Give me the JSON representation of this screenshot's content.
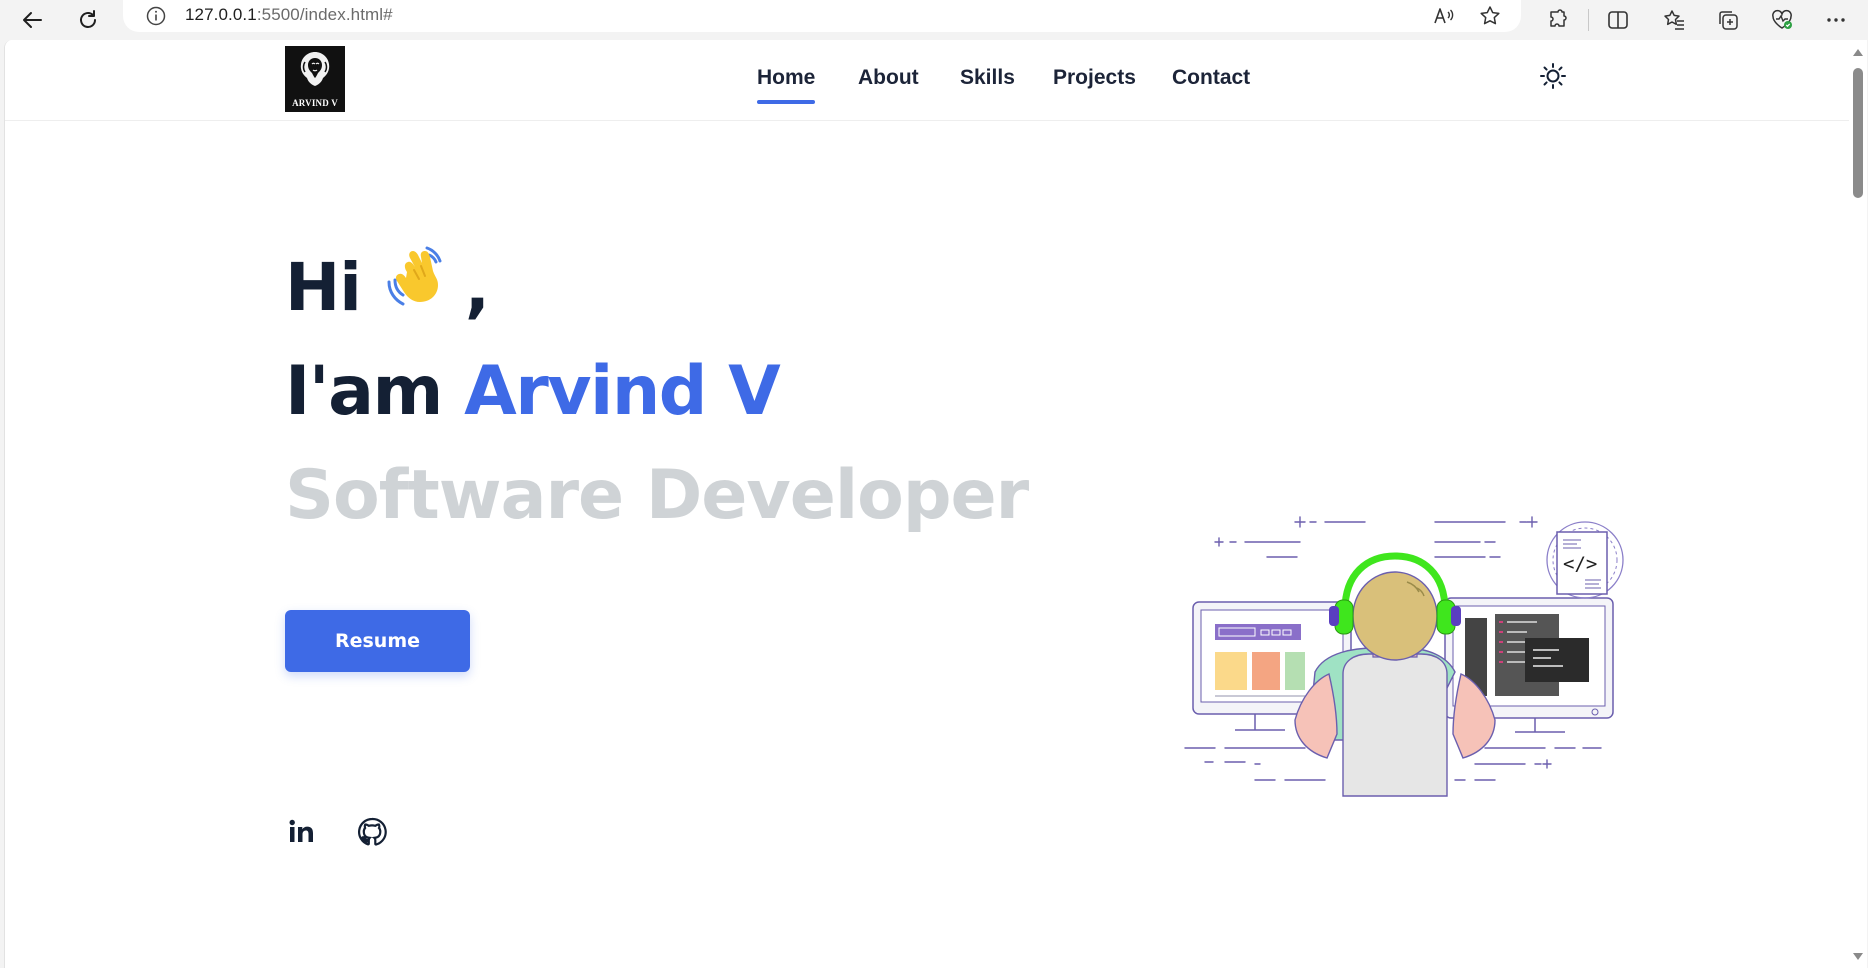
{
  "browser": {
    "url_host": "127.0.0.1",
    "url_rest": ":5500/index.html#"
  },
  "logo": {
    "text": "ARVIND V"
  },
  "nav": {
    "items": [
      {
        "label": "Home"
      },
      {
        "label": "About"
      },
      {
        "label": "Skills"
      },
      {
        "label": "Projects"
      },
      {
        "label": "Contact"
      }
    ],
    "active_index": 0
  },
  "hero": {
    "greeting": "Hi",
    "greeting_suffix": ",",
    "intro": "I'am",
    "name": "Arvind V",
    "role": "Software Developer",
    "resume_label": "Resume"
  },
  "social": {
    "linkedin_label": "in"
  },
  "icons": [
    "back-arrow-icon",
    "refresh-icon",
    "info-icon",
    "read-aloud-icon",
    "favorite-star-icon",
    "extensions-icon",
    "split-screen-icon",
    "favorites-icon",
    "collections-icon",
    "browser-essentials-icon",
    "more-icon",
    "sun-icon",
    "waving-hand-icon",
    "linkedin-icon",
    "github-icon"
  ],
  "colors": {
    "accent": "#3e6ae6",
    "heading": "#142034",
    "role_gray": "#cfd3d6",
    "nav_text": "#1c2438"
  }
}
